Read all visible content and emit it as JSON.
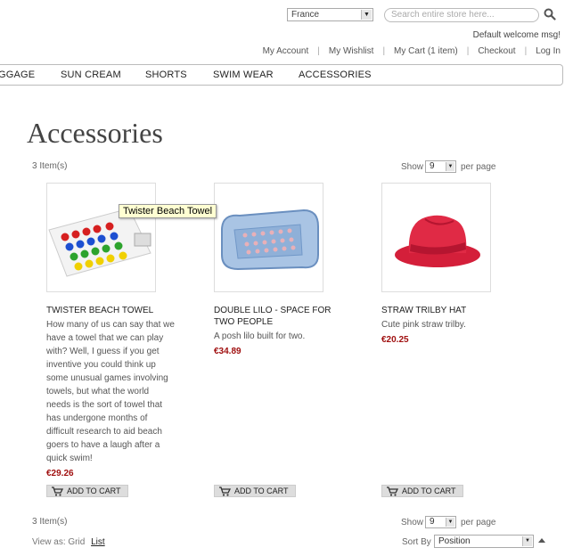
{
  "header": {
    "country": "France",
    "search_placeholder": "Search entire store here...",
    "welcome": "Default welcome msg!",
    "links": [
      "My Account",
      "My Wishlist",
      "My Cart (1 item)",
      "Checkout",
      "Log In"
    ]
  },
  "nav": {
    "items": [
      "GGAGE",
      "SUN CREAM",
      "SHORTS",
      "SWIM WEAR",
      "ACCESSORIES"
    ]
  },
  "page": {
    "title": "Accessories"
  },
  "toolbar_top": {
    "count": "3 Item(s)",
    "show_label": "Show",
    "per_page_value": "9",
    "per_page_label": "per page"
  },
  "toolbar_bottom": {
    "count": "3 Item(s)",
    "show_label": "Show",
    "per_page_value": "9",
    "per_page_label": "per page",
    "view_as_label": "View as:",
    "view_grid": "Grid",
    "view_list": "List",
    "sort_label": "Sort By",
    "sort_value": "Position"
  },
  "products": [
    {
      "name": "Twister Beach Towel",
      "description": "How many of us can say that we have a towel that we can play with? Well, I guess if you get inventive you could think up some unusual games involving towels, but what the world needs is the sort of towel that has undergone months of difficult research to aid beach goers to have a laugh after a quick swim!",
      "price": "€29.26",
      "button": "ADD TO CART"
    },
    {
      "name": "Double Lilo - Space for Two People",
      "description": "A posh lilo built for two.",
      "price": "€34.89",
      "button": "ADD TO CART"
    },
    {
      "name": "Straw Trilby Hat",
      "description": "Cute pink straw trilby.",
      "price": "€20.25",
      "button": "ADD TO CART"
    }
  ],
  "tooltip": "Twister Beach Towel",
  "colors": {
    "price": "#a01010",
    "tooltip_bg": "#ffffd2",
    "button_bg": "#dddddd"
  }
}
